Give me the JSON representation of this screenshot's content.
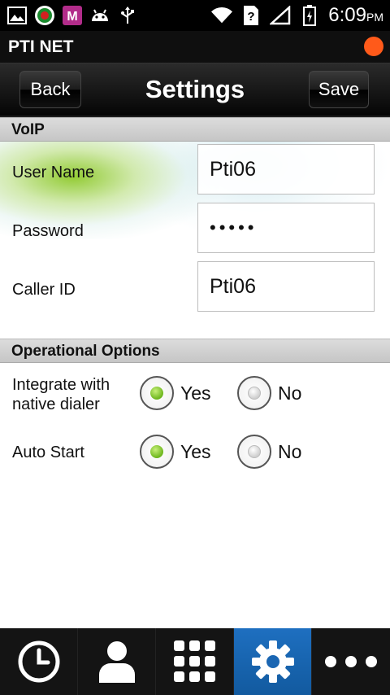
{
  "status_bar": {
    "time": "6:09",
    "ampm": "PM",
    "left_icons": [
      "gallery-icon",
      "party-logo-icon",
      "m-app-icon",
      "android-debug-icon",
      "usb-icon"
    ],
    "right_icons": [
      "wifi-icon",
      "sim-unknown-icon",
      "signal-icon",
      "battery-icon"
    ]
  },
  "app": {
    "name": "PTI NET",
    "indicator_color": "#ff5a1a"
  },
  "header": {
    "back_label": "Back",
    "title": "Settings",
    "save_label": "Save"
  },
  "voip": {
    "section_title": "VoIP",
    "username_label": "User Name",
    "username_value": "Pti06",
    "password_label": "Password",
    "password_value": "•••••",
    "callerid_label": "Caller ID",
    "callerid_value": "Pti06"
  },
  "options": {
    "section_title": "Operational Options",
    "integrate_label_line1": "Integrate with",
    "integrate_label_line2": "native dialer",
    "integrate_selected": "Yes",
    "autostart_label": "Auto Start",
    "autostart_selected": "Yes",
    "yes_label": "Yes",
    "no_label": "No"
  },
  "bottom_nav": {
    "items": [
      "clock-icon",
      "contact-icon",
      "dialpad-icon",
      "settings-gear-icon",
      "more-dots-icon"
    ],
    "active_index": 3,
    "active_color": "#1e6fc0"
  }
}
